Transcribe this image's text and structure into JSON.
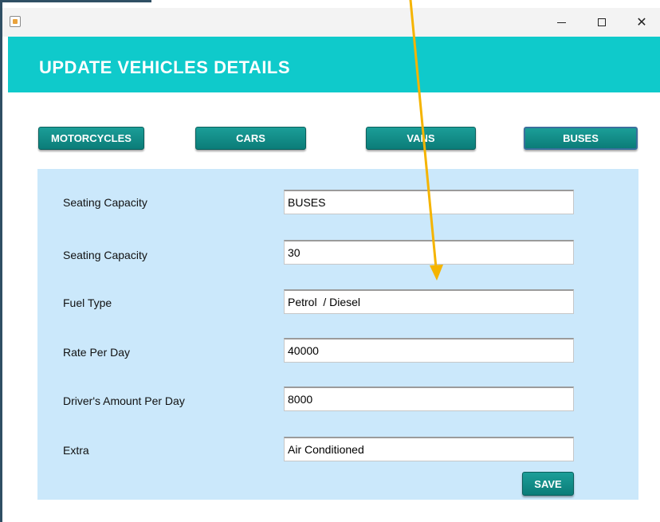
{
  "window": {
    "icon": "java-cup-icon",
    "controls": {
      "minimize_icon": "minimize-icon",
      "maximize_icon": "maximize-icon",
      "close_glyph": "✕"
    }
  },
  "header": {
    "title": "UPDATE VEHICLES DETAILS",
    "color": "#0fcacb"
  },
  "categories": [
    {
      "label": "MOTORCYCLES"
    },
    {
      "label": "CARS"
    },
    {
      "label": "VANS"
    },
    {
      "label": "BUSES"
    }
  ],
  "form": {
    "fields": [
      {
        "label": "Seating Capacity",
        "value": "BUSES"
      },
      {
        "label": "Seating Capacity",
        "value": "30"
      },
      {
        "label": "Fuel Type",
        "value": "Petrol  / Diesel"
      },
      {
        "label": "Rate Per Day",
        "value": "40000"
      },
      {
        "label": "Driver's Amount Per Day",
        "value": "8000"
      },
      {
        "label": "Extra",
        "value": "Air Conditioned"
      }
    ],
    "save_label": "SAVE",
    "panel_color": "#cbe8fb",
    "button_color": "#0b7c78"
  },
  "annotation": {
    "icon": "arrow-annotation-icon",
    "color": "#f5b400"
  }
}
